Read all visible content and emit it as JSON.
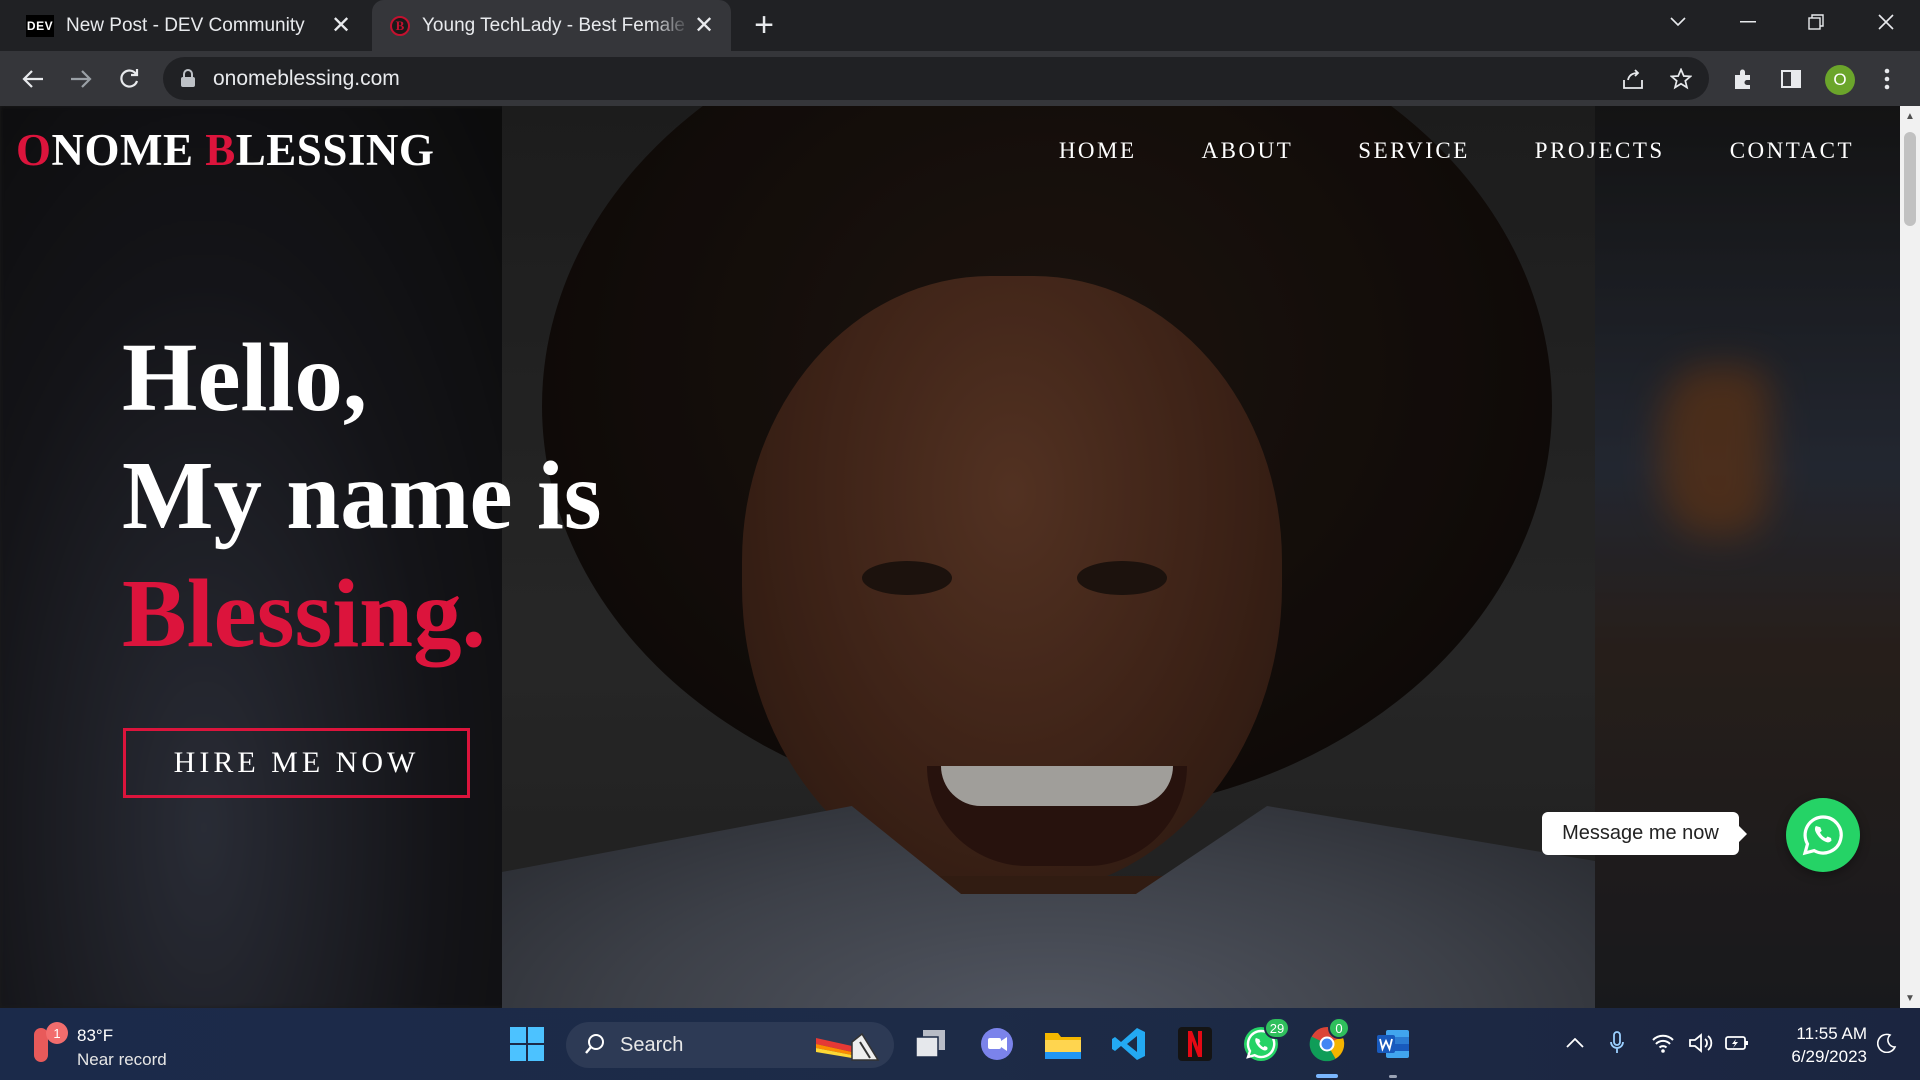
{
  "browser": {
    "tabs": [
      {
        "title": "New Post - DEV Community",
        "favicon": "DEV",
        "active": false
      },
      {
        "title": "Young TechLady - Best Female Developer",
        "favicon": "B",
        "active": true
      }
    ],
    "url": "onomeblessing.com",
    "profile_initial": "O"
  },
  "site": {
    "logo_first_initial": "O",
    "logo_first_rest": "NOME",
    "logo_second_initial": "B",
    "logo_second_rest": "LESSING",
    "nav": [
      "HOME",
      "ABOUT",
      "SERVICE",
      "PROJECTS",
      "CONTACT"
    ],
    "hero": {
      "line1": "Hello,",
      "line2": "My name is",
      "line3": "Blessing."
    },
    "cta": "HIRE ME NOW",
    "whatsapp_message": "Message me now",
    "accent_color": "#dc143c",
    "whatsapp_color": "#25d366"
  },
  "taskbar": {
    "weather_temp": "83°F",
    "weather_cond": "Near record",
    "weather_badge": "1",
    "search_label": "Search",
    "whatsapp_badge": "29",
    "chrome_badge": "0",
    "time": "11:55 AM",
    "date": "6/29/2023"
  }
}
